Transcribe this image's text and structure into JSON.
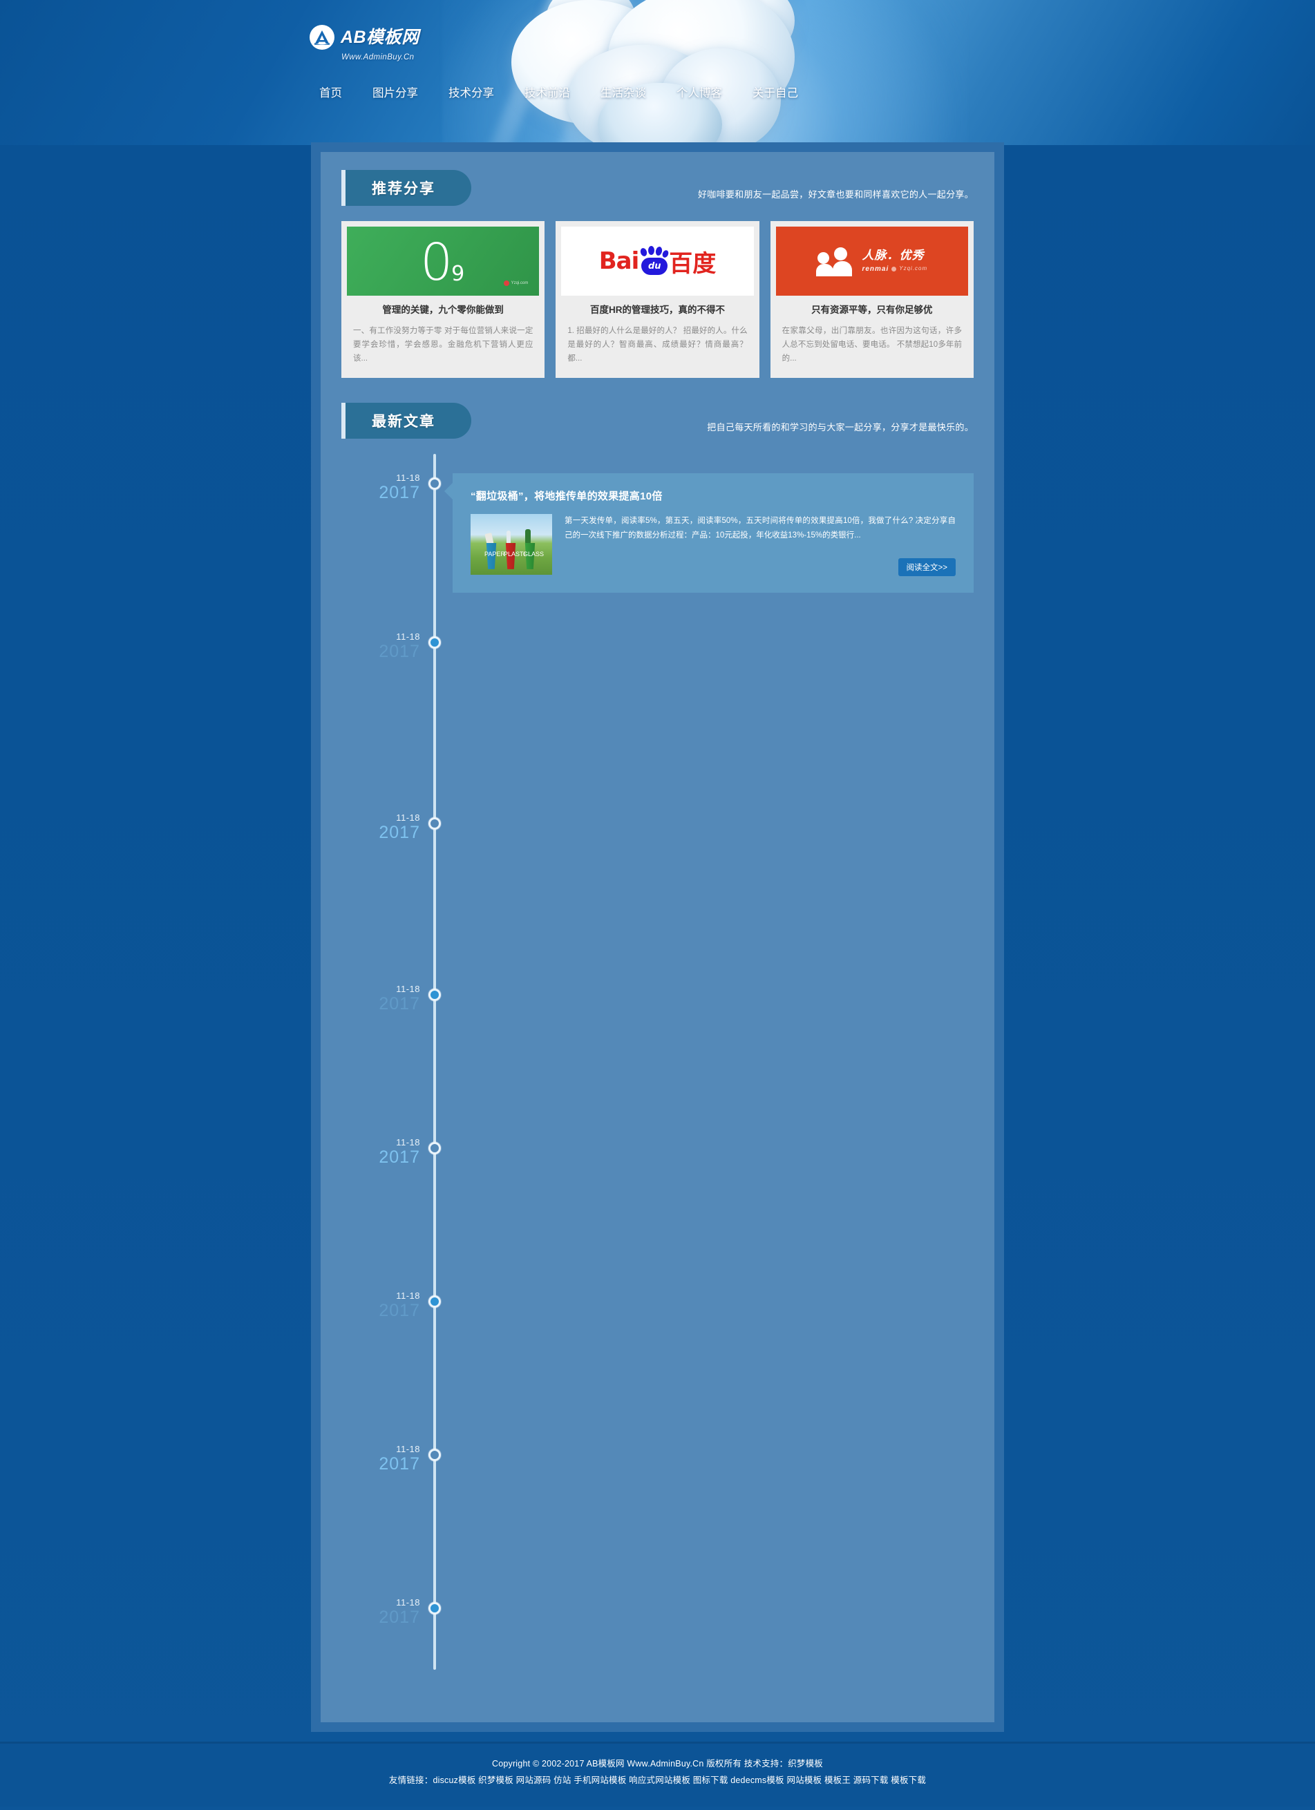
{
  "site": {
    "logo_text": "AB模板网",
    "logo_url": "Www.AdminBuy.Cn",
    "logo_icon": "ab-logo-icon"
  },
  "nav": {
    "items": [
      {
        "label": "首页"
      },
      {
        "label": "图片分享"
      },
      {
        "label": "技术分享"
      },
      {
        "label": "技术前沿"
      },
      {
        "label": "生活杂谈"
      },
      {
        "label": "个人博客"
      },
      {
        "label": "关于自己"
      }
    ]
  },
  "recommend": {
    "title": "推荐分享",
    "subtitle": "好咖啡要和朋友一起品尝，好文章也要和同样喜欢它的人一起分享。",
    "cards": [
      {
        "thumb_kind": "green-zero",
        "thumb_main": "0",
        "thumb_sub": "9",
        "thumb_watermark": "Yzqi.com",
        "title": "管理的关键，九个零你能做到",
        "desc": "一、有工作没努力等于零 对于每位营销人来说一定要学会珍惜，学会感恩。金融危机下营销人更应该..."
      },
      {
        "thumb_kind": "baidu-logo",
        "thumb_main": "Bai",
        "thumb_sub": "du",
        "thumb_cn": "百度",
        "title": "百度HR的管理技巧，真的不得不",
        "desc": "1. 招最好的人什么是最好的人？ 招最好的人。什么是最好的人？智商最高、成绩最好？情商最高？都..."
      },
      {
        "thumb_kind": "renmai-logo",
        "thumb_main": "人脉．优秀",
        "thumb_sub": "renmai",
        "thumb_watermark": "Yzqi.com",
        "title": "只有资源平等，只有你足够优",
        "desc": "在家靠父母，出门靠朋友。也许因为这句话，许多人总不忘到处留电话、要电话。 不禁想起10多年前的..."
      }
    ]
  },
  "latest": {
    "title": "最新文章",
    "subtitle": "把自己每天所看的和学习的与大家一起分享，分享才是最快乐的。",
    "read_more": "阅读全文>>",
    "items": [
      {
        "month_day": "11-18",
        "year": "2017",
        "dim": false,
        "hollow": true,
        "has_card": true,
        "title": "“翻垃圾桶”，将地推传单的效果提高10倍",
        "desc": "第一天发传单，阅读率5%，第五天，阅读率50%，五天时间将传单的效果提高10倍，我做了什么? 决定分享自己的一次线下推广的数据分析过程：产品：10元起投，年化收益13%-15%的类银行...",
        "thumb_labels": [
          "PAPER",
          "PLASTIC",
          "GLASS"
        ]
      },
      {
        "month_day": "11-18",
        "year": "2017",
        "dim": true,
        "hollow": false,
        "has_card": false
      },
      {
        "month_day": "11-18",
        "year": "2017",
        "dim": false,
        "hollow": true,
        "has_card": false
      },
      {
        "month_day": "11-18",
        "year": "2017",
        "dim": true,
        "hollow": false,
        "has_card": false
      },
      {
        "month_day": "11-18",
        "year": "2017",
        "dim": false,
        "hollow": true,
        "has_card": false
      },
      {
        "month_day": "11-18",
        "year": "2017",
        "dim": true,
        "hollow": false,
        "has_card": false
      },
      {
        "month_day": "11-18",
        "year": "2017",
        "dim": false,
        "hollow": true,
        "has_card": false
      },
      {
        "month_day": "11-18",
        "year": "2017",
        "dim": true,
        "hollow": false,
        "has_card": false
      }
    ]
  },
  "footer": {
    "copyright": "Copyright © 2002-2017 AB模板网 Www.AdminBuy.Cn 版权所有 技术支持：织梦模板",
    "links_label": "友情链接：",
    "links": [
      "discuz模板",
      "织梦模板",
      "网站源码",
      "仿站",
      "手机网站模板",
      "响应式网站模板",
      "图标下载",
      "dedecms模板",
      "网站模板",
      "模板王",
      "源码下载",
      "模板下载"
    ]
  },
  "colors": {
    "page_bg": "#0a5396",
    "outer_panel": "#2e6da8",
    "inner_panel": "#5489b8",
    "section_badge": "#2b7097",
    "card_bg": "#ededed",
    "timeline_card": "#5f9bc4",
    "read_more_btn": "#1b72b8",
    "accent_year": "#7ec2ef",
    "footer_bg": "#0c5496"
  }
}
